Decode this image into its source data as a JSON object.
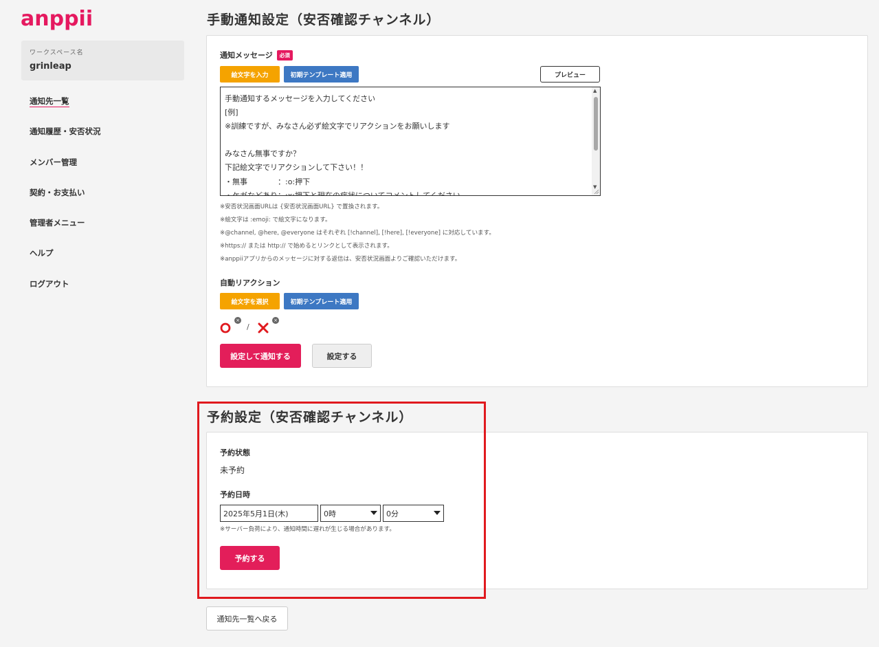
{
  "app": {
    "logo": "anppii"
  },
  "workspace": {
    "label": "ワークスペース名",
    "name": "grinleap"
  },
  "sidebar": {
    "items": [
      {
        "label": "通知先一覧"
      },
      {
        "label": "通知履歴・安否状況"
      },
      {
        "label": "メンバー管理"
      },
      {
        "label": "契約・お支払い"
      },
      {
        "label": "管理者メニュー"
      },
      {
        "label": "ヘルプ"
      },
      {
        "label": "ログアウト"
      }
    ]
  },
  "manual": {
    "title": "手動通知設定（安否確認チャンネル）",
    "message_label": "通知メッセージ",
    "required_badge": "必須",
    "emoji_input_btn": "絵文字を入力",
    "template_btn": "初期テンプレート適用",
    "preview_btn": "プレビュー",
    "message_value": "手動通知するメッセージを入力してください\n[例]\n※訓練ですが、みなさん必ず絵文字でリアクションをお願いします\n\nみなさん無事ですか？\n下記絵文字でリアクションして下さい！！\n・無事　　　　：:o:押下\n・ケガなどあり：:x:押下と現在の症状についてコメントしてください",
    "notes": [
      "※安否状況画面URLは {安否状況画面URL} で置換されます。",
      "※絵文字は :emoji: で絵文字になります。",
      "※@channel, @here, @everyone はそれぞれ [!channel], [!here], [!everyone] に対応しています。",
      "※https:// または http:// で始めるとリンクとして表示されます。",
      "※anppiiアプリからのメッセージに対する返信は、安否状況画面よりご確認いただけます。"
    ],
    "auto_reaction_label": "自動リアクション",
    "emoji_select_btn": "絵文字を選択",
    "template_btn2": "初期テンプレート適用",
    "reactions": {
      "first": "⭕",
      "separator": "/",
      "second": "❌",
      "remove": "×"
    },
    "set_and_notify_btn": "設定して通知する",
    "set_btn": "設定する"
  },
  "schedule": {
    "title": "予約設定（安否確認チャンネル）",
    "status_label": "予約状態",
    "status_value": "未予約",
    "datetime_label": "予約日時",
    "date_value": "2025年5月1日(木)",
    "hour_value": "0時",
    "minute_value": "0分",
    "note": "※サーバー負荷により、通知時間に遅れが生じる場合があります。",
    "reserve_btn": "予約する"
  },
  "back_btn": "通知先一覧へ戻る",
  "colors": {
    "brand": "#e5195f",
    "orange": "#f5a300",
    "blue": "#3d78c3",
    "highlight": "#e0191e"
  }
}
